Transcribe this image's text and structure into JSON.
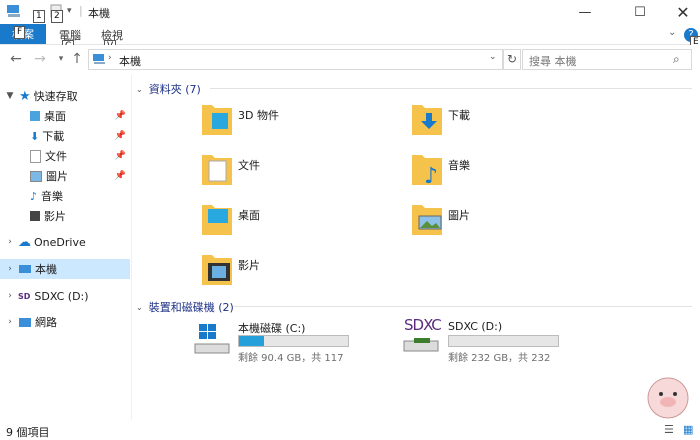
{
  "window": {
    "title": "本機",
    "keytips": {
      "qat1": "1",
      "qat2": "2",
      "file": "F",
      "computer": "C",
      "view": "V",
      "help": "E"
    }
  },
  "ribbon": {
    "file_label": "檔案",
    "tabs": [
      "電腦",
      "檢視"
    ]
  },
  "addressbar": {
    "path": "本機",
    "search_placeholder": "搜尋 本機"
  },
  "navpane": {
    "quick_access": "快速存取",
    "quick_items": [
      "桌面",
      "下載",
      "文件",
      "圖片",
      "音樂",
      "影片"
    ],
    "onedrive": "OneDrive",
    "this_pc": "本機",
    "sdxc": "SDXC (D:)",
    "network": "網路"
  },
  "content": {
    "folders_header": "資料夾 (7)",
    "folders": [
      "3D 物件",
      "下載",
      "文件",
      "音樂",
      "桌面",
      "圖片",
      "影片"
    ],
    "drives_header": "裝置和磁碟機 (2)",
    "drives": [
      {
        "name": "本機磁碟 (C:)",
        "free": "剩餘 90.4 GB，共 117",
        "used_fraction": 0.23
      },
      {
        "name": "SDXC (D:)",
        "free": "剩餘 232 GB，共 232",
        "used_fraction": 0.0
      }
    ],
    "sdxc_logo": "SDXC"
  },
  "statusbar": {
    "count": "9 個項目"
  },
  "colors": {
    "accent": "#1979ca",
    "selection": "#cce8ff",
    "header": "#1e3287",
    "folder": "#f5c34b"
  }
}
